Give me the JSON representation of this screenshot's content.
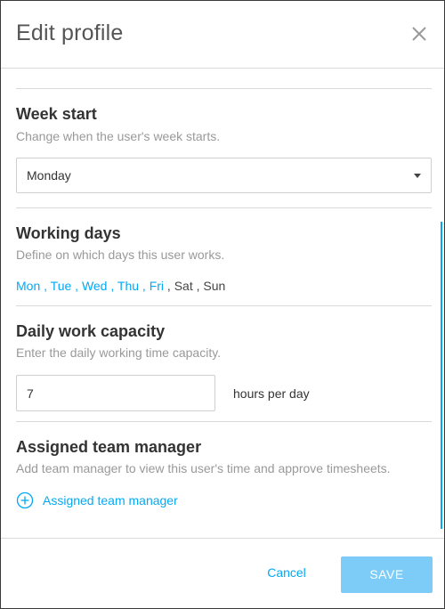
{
  "dialog": {
    "title": "Edit profile"
  },
  "week_start": {
    "title": "Week start",
    "description": "Change when the user's week starts.",
    "selected": "Monday"
  },
  "working_days": {
    "title": "Working days",
    "description": "Define on which days this user works.",
    "days": [
      {
        "label": "Mon",
        "active": true
      },
      {
        "label": "Tue",
        "active": true
      },
      {
        "label": "Wed",
        "active": true
      },
      {
        "label": "Thu",
        "active": true
      },
      {
        "label": "Fri",
        "active": true
      },
      {
        "label": "Sat",
        "active": false
      },
      {
        "label": "Sun",
        "active": false
      }
    ],
    "separator": " , "
  },
  "daily_capacity": {
    "title": "Daily work capacity",
    "description": "Enter the daily working time capacity.",
    "value": "7",
    "unit": "hours per day"
  },
  "team_manager": {
    "title": "Assigned team manager",
    "description": "Add team manager to view this user's time and approve timesheets.",
    "add_label": "Assigned team manager"
  },
  "footer": {
    "cancel_label": "Cancel",
    "save_label": "SAVE"
  },
  "colors": {
    "accent": "#03a9f4",
    "save_disabled": "#7dccf8",
    "title_text": "#333333",
    "muted_text": "#999999"
  }
}
